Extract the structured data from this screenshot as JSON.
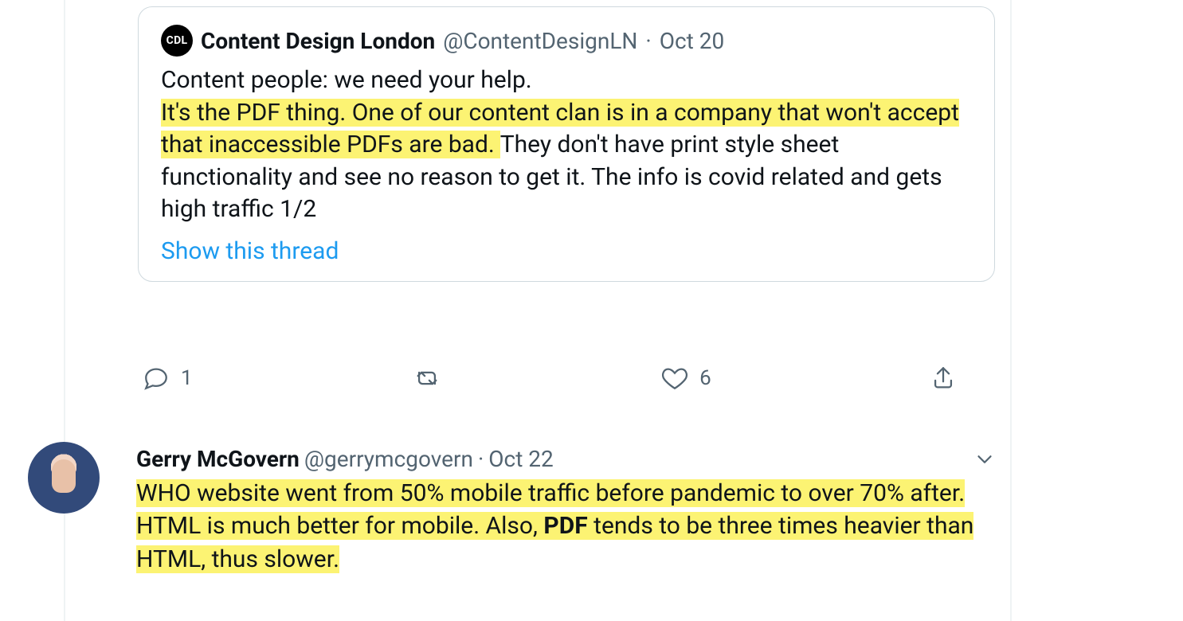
{
  "quoted_tweet": {
    "avatar_text": "CDL",
    "author_name": "Content Design London",
    "author_handle": "@ContentDesignLN",
    "date_sep": " · ",
    "date": "Oct 20",
    "body_line1": "Content people: we need your help.",
    "body_highlight": "It's the PDF thing. One of our content clan is in a company that won't accept that inaccessible PDFs are bad. ",
    "body_rest": "They don't have print style sheet functionality and see no reason to get it. The info is covid related and gets high traffic 1/2",
    "show_thread_label": "Show this thread"
  },
  "actions": {
    "reply_count": "1",
    "like_count": "6"
  },
  "tweet2": {
    "author_name": "Gerry McGovern",
    "author_handle": "@gerrymcgovern",
    "date_sep": " · ",
    "date": "Oct 22",
    "body_pre": "WHO website went from 50% mobile traffic before pandemic to over 70% after. HTML is much better for mobile. Also, ",
    "body_bold": "PDF",
    "body_post": " tends to be three times heavier than HTML, thus slower."
  }
}
